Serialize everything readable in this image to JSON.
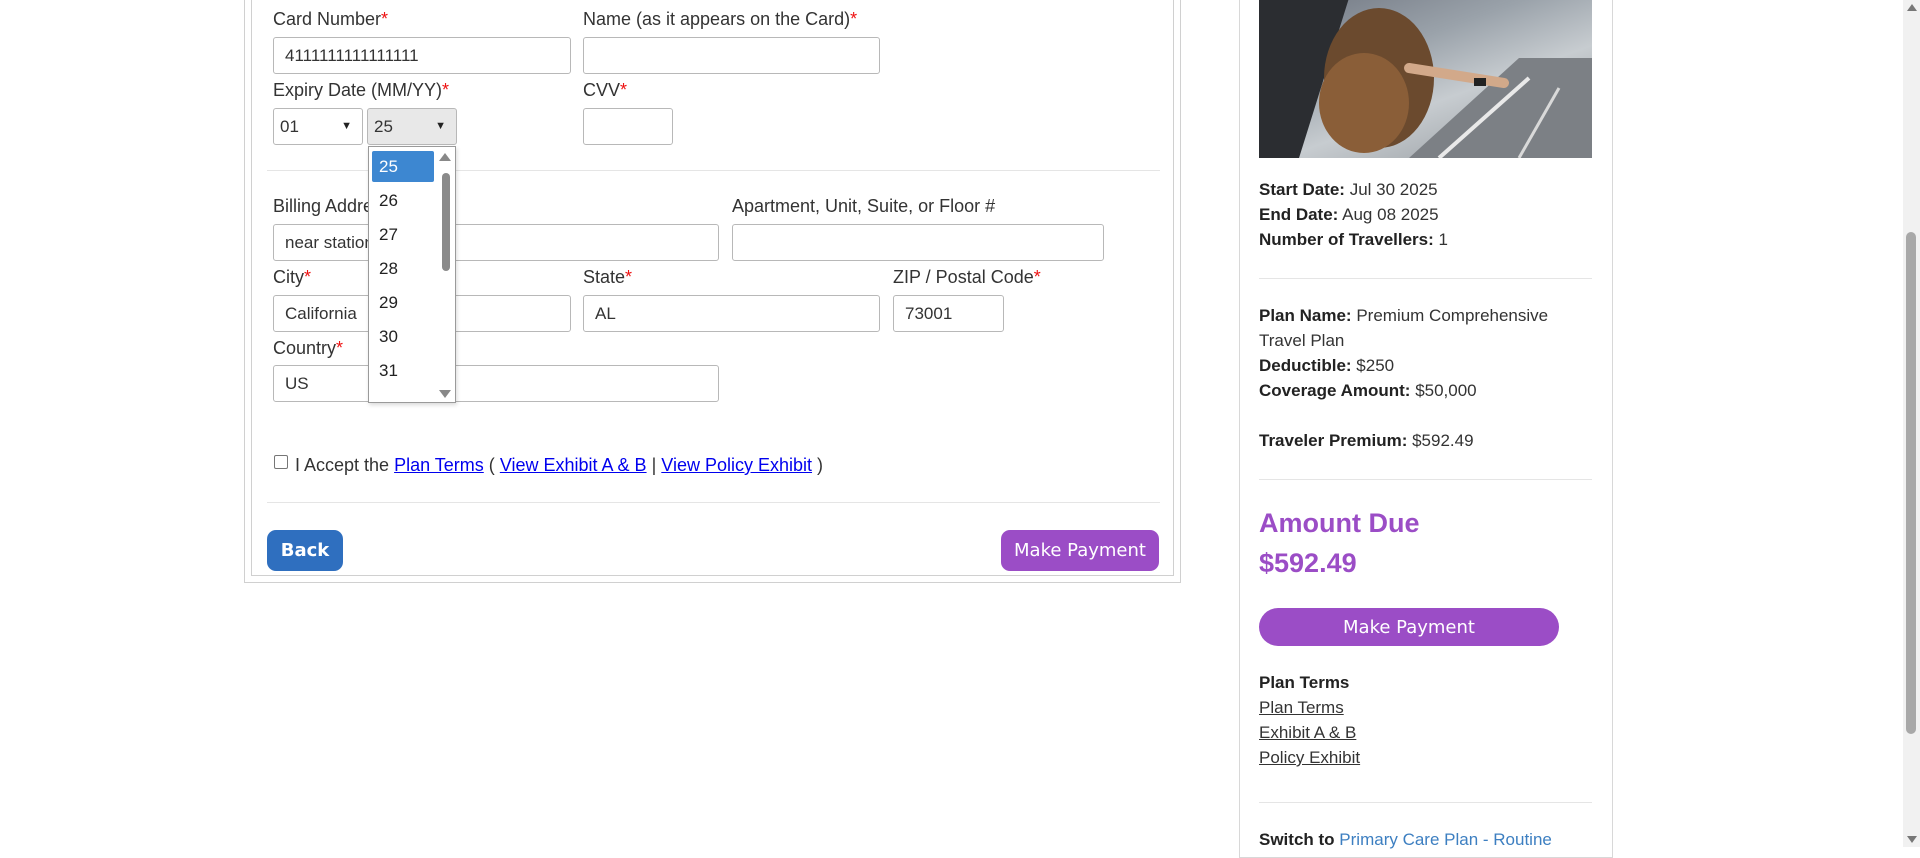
{
  "payment": {
    "card_number_label": "Card Number",
    "card_number_value": "4111111111111111",
    "name_label": "Name (as it appears on the Card)",
    "name_value": "",
    "expiry_label": "Expiry Date (MM/YY)",
    "expiry_month": "01",
    "expiry_year": "25",
    "cvv_label": "CVV",
    "cvv_value": ""
  },
  "year_dropdown": {
    "options": [
      "25",
      "26",
      "27",
      "28",
      "29",
      "30",
      "31"
    ],
    "selected": "25"
  },
  "billing": {
    "address_label": "Billing Address",
    "address_value": "near station",
    "apartment_label": "Apartment, Unit, Suite, or Floor #",
    "apartment_value": "",
    "city_label": "City",
    "city_value": "California",
    "state_label": "State",
    "state_value": "AL",
    "zip_label": "ZIP / Postal Code",
    "zip_value": "73001",
    "country_label": "Country",
    "country_value": "US"
  },
  "terms": {
    "prefix": "I Accept the",
    "plan_terms": "Plan Terms",
    "open_paren": "(",
    "exhibit_ab": "View Exhibit A & B",
    "separator": "|",
    "policy_exhibit": "View Policy Exhibit",
    "close_paren": ")"
  },
  "buttons": {
    "back": "Back",
    "make_payment": "Make Payment"
  },
  "summary": {
    "start_date_label": "Start Date:",
    "start_date": "Jul 30 2025",
    "end_date_label": "End Date:",
    "end_date": "Aug 08 2025",
    "travellers_label": "Number of Travellers:",
    "travellers": "1",
    "plan_name_label": "Plan Name:",
    "plan_name_line1": "Premium Comprehensive",
    "plan_name_line2": "Travel Plan",
    "deductible_label": "Deductible:",
    "deductible": "$250",
    "coverage_label": "Coverage Amount:",
    "coverage": "$50,000",
    "premium_label": "Traveler Premium:",
    "premium": "$592.49",
    "amount_due_label": "Amount Due",
    "amount_due": "$592.49",
    "make_payment": "Make Payment",
    "plan_terms_heading": "Plan Terms",
    "links": [
      "Plan Terms",
      "Exhibit A & B",
      "Policy Exhibit"
    ],
    "switch_label": "Switch to",
    "switch_link": "Primary Care Plan - Routine"
  },
  "colors": {
    "back_button": "#2f6fbf",
    "purple": "#9b4dc6",
    "selected_option": "#3d87d1",
    "required": "#ee1111",
    "link": "#0000ee",
    "switch_link": "#3d7fc1"
  }
}
